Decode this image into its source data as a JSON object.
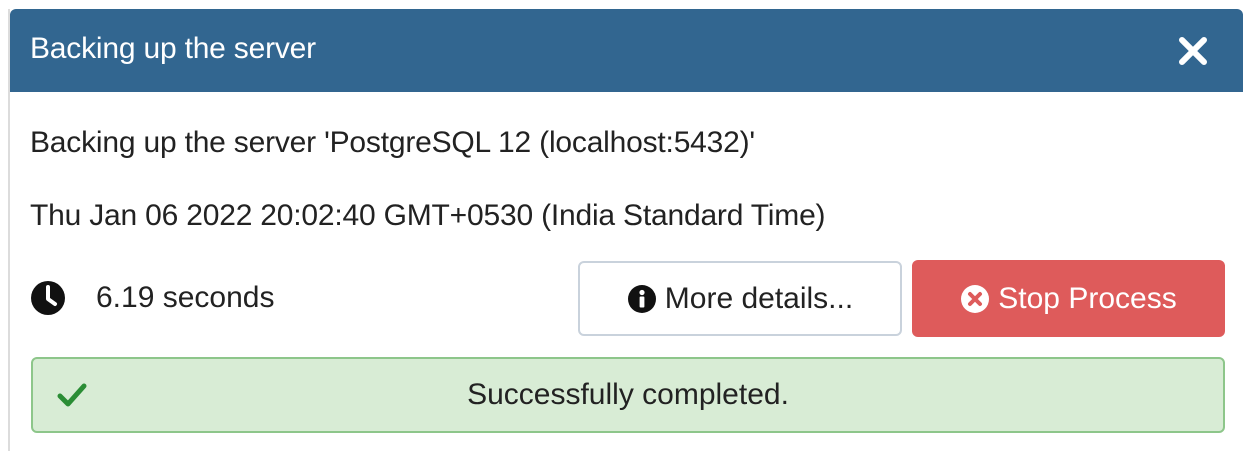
{
  "dialog": {
    "title": "Backing up the server",
    "close_icon": "close-icon"
  },
  "body": {
    "line1": "Backing up the server 'PostgreSQL 12 (localhost:5432)'",
    "line2": "Thu Jan 06 2022 20:02:40 GMT+0530 (India Standard Time)",
    "clock_icon": "clock-icon",
    "elapsed": "6.19 seconds"
  },
  "buttons": {
    "more_details": {
      "icon": "info-circle-icon",
      "label": "More details..."
    },
    "stop_process": {
      "icon": "times-circle-icon",
      "label": "Stop Process"
    }
  },
  "status": {
    "icon": "check-icon",
    "message": "Successfully completed."
  },
  "colors": {
    "header": "#326690",
    "stop_button": "#de5b5b",
    "success_bg": "#d8ecd5",
    "success_border": "#8dc68a",
    "success_check": "#2a8d35"
  }
}
